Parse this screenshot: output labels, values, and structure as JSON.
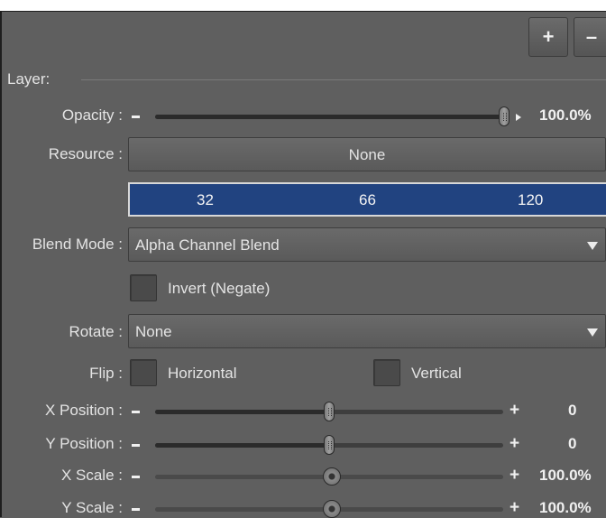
{
  "toolbar": {
    "add_label": "+",
    "remove_label": "–"
  },
  "layer": {
    "section_title": "Layer:",
    "opacity": {
      "label": "Opacity :",
      "value_text": "100.0%",
      "value": 1.0
    },
    "resource": {
      "label": "Resource :",
      "value": "None"
    },
    "color": {
      "r": "32",
      "g": "66",
      "b": "120",
      "hex": "#204278"
    },
    "blend_mode": {
      "label": "Blend Mode :",
      "value": "Alpha Channel Blend"
    },
    "invert": {
      "label": "Invert (Negate)",
      "checked": false
    },
    "rotate": {
      "label": "Rotate :",
      "value": "None"
    },
    "flip": {
      "label": "Flip :",
      "horizontal_label": "Horizontal",
      "vertical_label": "Vertical",
      "horizontal": false,
      "vertical": false
    },
    "x_position": {
      "label": "X Position :",
      "value_text": "0",
      "value": 0.5
    },
    "y_position": {
      "label": "Y Position :",
      "value_text": "0",
      "value": 0.5
    },
    "x_scale": {
      "label": "X Scale :",
      "value_text": "100.0%",
      "value": 0.5
    },
    "y_scale": {
      "label": "Y Scale :",
      "value_text": "100.0%",
      "value": 0.5
    }
  }
}
